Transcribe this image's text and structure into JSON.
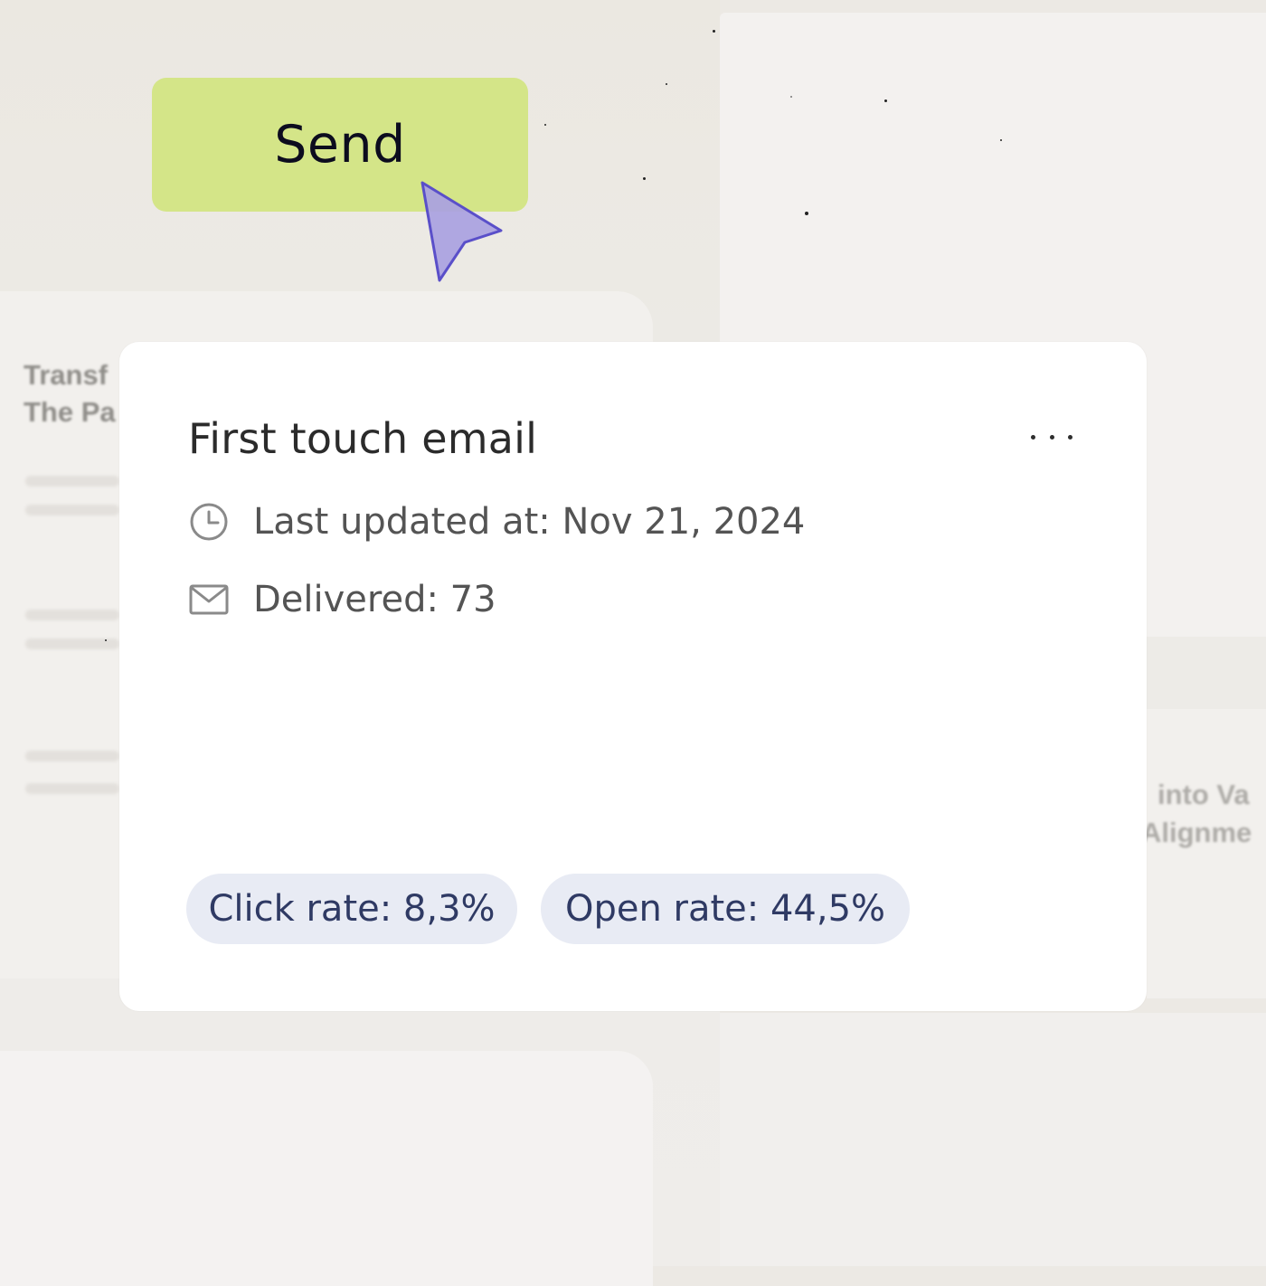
{
  "send_button": {
    "label": "Send"
  },
  "background": {
    "left_card_title_lines": [
      "Transf",
      "The Pa"
    ],
    "right_card_title_lines": [
      "into Va",
      "Alignme"
    ]
  },
  "card": {
    "title": "First touch email",
    "menu_icon": "more-horizontal-icon",
    "last_updated": {
      "icon": "clock-icon",
      "text": "Last updated at: Nov 21, 2024"
    },
    "delivered": {
      "icon": "mail-icon",
      "text": "Delivered: 73"
    },
    "badges": {
      "click_rate": "Click rate: 8,3%",
      "open_rate": "Open rate: 44,5%"
    }
  },
  "colors": {
    "send_button": "#d4e588",
    "cursor_fill": "#a89fe0",
    "cursor_stroke": "#5a4fc9",
    "badge_bg": "#e8ebf4",
    "badge_text": "#2f3a64"
  }
}
